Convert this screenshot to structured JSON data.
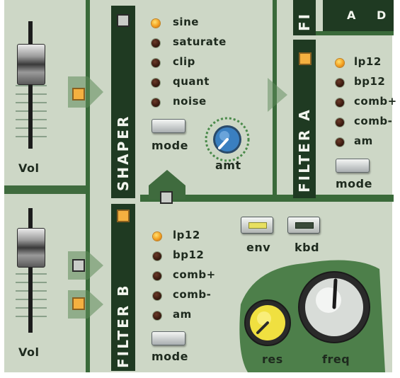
{
  "shaper": {
    "title": "SHAPER",
    "options": [
      "sine",
      "saturate",
      "clip",
      "quant",
      "noise"
    ],
    "selected": "sine",
    "mode_label": "mode",
    "knob_label": "amt"
  },
  "filter_a": {
    "title": "FILTER A",
    "options": [
      "lp12",
      "bp12",
      "comb+",
      "comb-",
      "am"
    ],
    "selected": "lp12",
    "mode_label": "mode"
  },
  "filter_b": {
    "title": "FILTER B",
    "options": [
      "lp12",
      "bp12",
      "comb+",
      "comb-",
      "am"
    ],
    "selected": "lp12",
    "mode_label": "mode",
    "env_label": "env",
    "kbd_label": "kbd",
    "res_label": "res",
    "freq_label": "freq"
  },
  "vol_top": {
    "label": "Vol"
  },
  "vol_bottom": {
    "label": "Vol"
  },
  "top_strip": {
    "title_partial": "FI",
    "labels": [
      "A",
      "D"
    ]
  },
  "colors": {
    "panel": "#cdd7c6",
    "dark_green": "#3a6a3a",
    "strip_green": "#1f3a22",
    "led_on": "#f4a020",
    "amt_knob": "#3a7fc0",
    "res_knob": "#f0e040"
  }
}
